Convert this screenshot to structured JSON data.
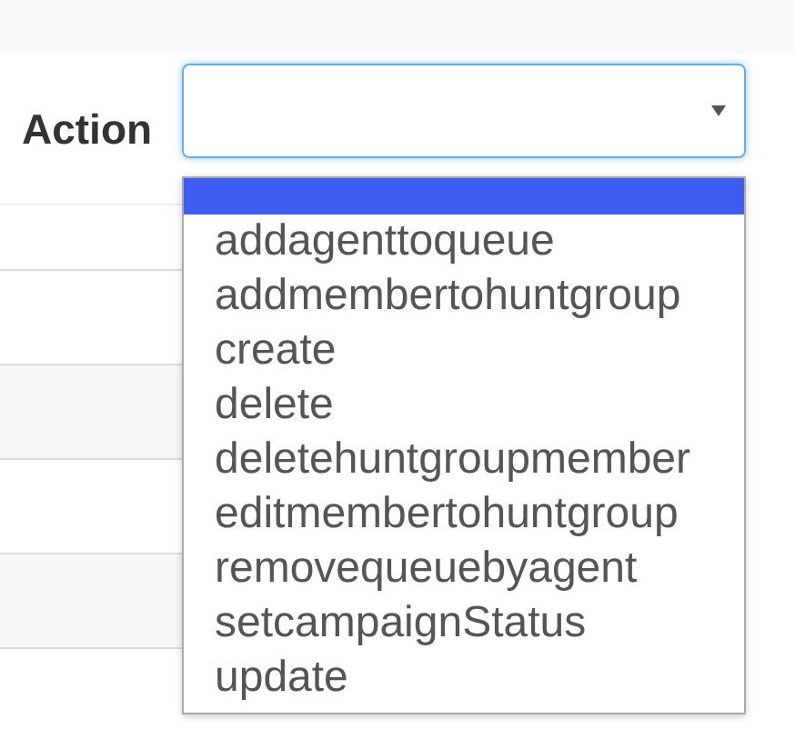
{
  "field": {
    "label": "Action",
    "expanded": true
  },
  "dropdown": {
    "options": [
      {
        "selected": true
      },
      {
        "label": "addagenttoqueue",
        "selected": false
      },
      {
        "label": "addmembertohuntgroup",
        "selected": false
      },
      {
        "label": "create",
        "selected": false
      },
      {
        "label": "delete",
        "selected": false
      },
      {
        "label": "deletehuntgroupmember",
        "selected": false
      },
      {
        "label": "editmembertohuntgroup",
        "selected": false
      },
      {
        "label": "removequeuebyagent",
        "selected": false
      },
      {
        "label": "setcampaignStatus",
        "selected": false
      },
      {
        "label": "update",
        "selected": false
      }
    ]
  }
}
